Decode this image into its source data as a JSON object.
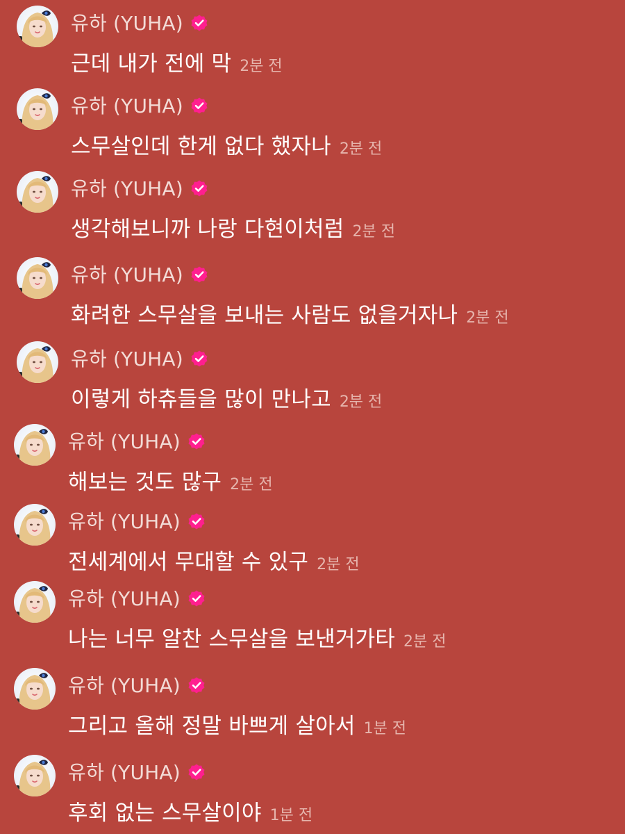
{
  "chat": {
    "sender_name": "유하 (YUHA)",
    "avatar_alt": "유하 (YUHA)",
    "verified_color": "#ff1f8f",
    "messages": [
      {
        "text": "근데 내가 전에 막",
        "time": "2분 전"
      },
      {
        "text": "스무살인데 한게 없다 했자나",
        "time": "2분 전"
      },
      {
        "text": "생각해보니까 나랑 다현이처럼",
        "time": "2분 전"
      },
      {
        "text": "화려한 스무살을 보내는 사람도 없을거자나",
        "time": "2분 전"
      },
      {
        "text": "이렇게 하츄들을 많이 만나고",
        "time": "2분 전"
      },
      {
        "text": "해보는 것도 많구",
        "time": "2분 전"
      },
      {
        "text": "전세계에서 무대할 수 있구",
        "time": "2분 전"
      },
      {
        "text": "나는 너무 알찬 스무살을 보낸거가타",
        "time": "2분 전"
      },
      {
        "text": "그리고 올해 정말 바쁘게 살아서",
        "time": "1분 전"
      },
      {
        "text": "후회 없는 스무살이야",
        "time": "1분 전"
      }
    ]
  }
}
